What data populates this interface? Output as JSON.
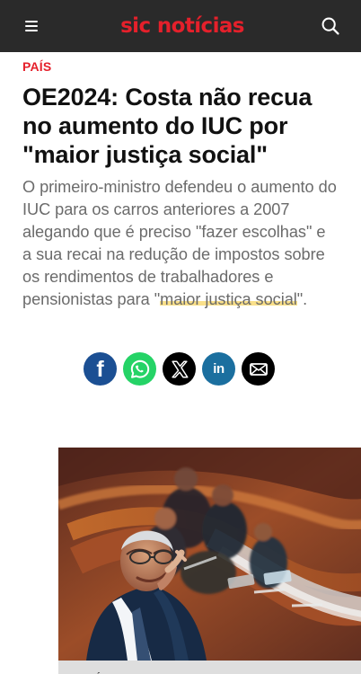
{
  "header": {
    "logo_text": "sic notícias",
    "logo_color": "#e5202b",
    "menu_icon": "hamburger-menu-icon",
    "search_icon": "search-icon"
  },
  "article": {
    "section_label": "PAÍS",
    "headline": "OE2024: Costa não recua no aumento do IUC por \"maior justiça social\"",
    "lead": {
      "before_highlight": "O primeiro-ministro defendeu o aumento do IUC para os carros anteriores a 2007 alegando que é preciso \"fazer escolhas\" e a sua recai na redução de impostos sobre os rendimentos de trabalhadores e pensionistas para \"",
      "highlight": "maior justiça social",
      "after_highlight": "\"."
    }
  },
  "share": {
    "icons": [
      "facebook-icon",
      "whatsapp-icon",
      "x-icon",
      "linkedin-icon",
      "email-icon"
    ],
    "colors": {
      "facebook": "#1b4f93",
      "whatsapp": "#25d366",
      "x": "#000000",
      "linkedin": "#1b6f9f",
      "email": "#000000"
    }
  },
  "media": {
    "credit": "ANTÓNIO COTRIM/LUSA"
  }
}
